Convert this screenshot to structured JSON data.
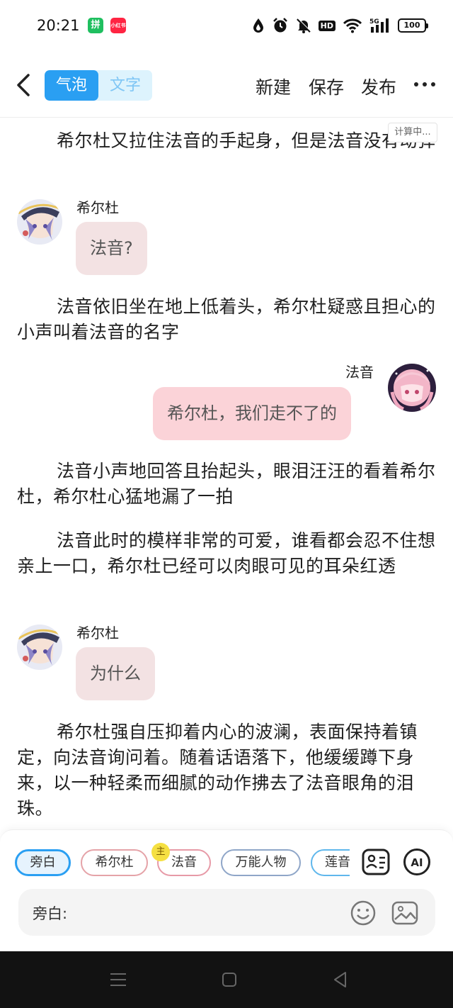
{
  "status_bar": {
    "time": "20:21",
    "app_badges": [
      "group-buy-icon",
      "xiaohongshu-icon"
    ],
    "red_badge_text": "小红书",
    "green_badge_text": "拼",
    "icons": [
      "data-saver-icon",
      "alarm-icon",
      "mute-icon",
      "hd-icon",
      "wifi-icon",
      "signal-5g-icon"
    ],
    "hd_label": "HD",
    "network_label": "5G",
    "battery": "100"
  },
  "nav": {
    "tabs": [
      {
        "label": "气泡",
        "active": true
      },
      {
        "label": "文字",
        "active": false
      }
    ],
    "new_label": "新建",
    "save_label": "保存",
    "publish_label": "发布",
    "more_label": "···"
  },
  "calc_tag": "计算中...",
  "story": {
    "p1": "希尔杜又拉住法音的手起身，但是法音没有动弹",
    "m1": {
      "speaker": "希尔杜",
      "text": "法音?"
    },
    "p2": "法音依旧坐在地上低着头，希尔杜疑惑且担心的小声叫着法音的名字",
    "m2": {
      "speaker": "法音",
      "text": "希尔杜，我们走不了的"
    },
    "p3": "法音小声地回答且抬起头，眼泪汪汪的看着希尔杜，希尔杜心猛地漏了一拍",
    "p4": "法音此时的模样非常的可爱，谁看都会忍不住想亲上一口，希尔杜已经可以肉眼可见的耳朵红透",
    "m3": {
      "speaker": "希尔杜",
      "text": "为什么"
    },
    "p5": "希尔杜强自压抑着内心的波澜，表面保持着镇定，向法音询问着。随着话语落下，他缓缓蹲下身来，以一种轻柔而细腻的动作拂去了法音眼角的泪珠。"
  },
  "characters": {
    "chips": [
      "旁白",
      "希尔杜",
      "法音",
      "万能人物",
      "莲音"
    ],
    "master_badge": "主"
  },
  "input": {
    "label": "旁白:"
  },
  "colors": {
    "accent": "#2a9ff2",
    "bubble_left": "#f3e2e3",
    "bubble_right": "#fbd3d8"
  }
}
